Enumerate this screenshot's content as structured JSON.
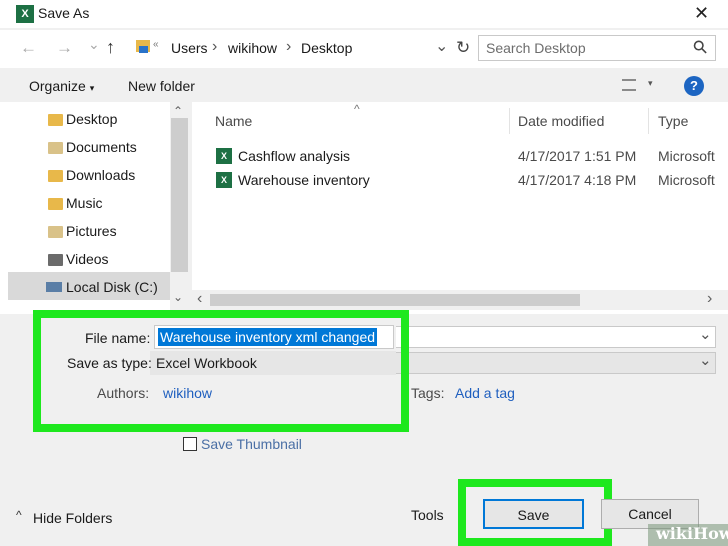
{
  "window": {
    "title": "Save As",
    "app_icon_text": "X",
    "close_glyph": "✕"
  },
  "nav": {
    "back_glyph": "←",
    "forward_glyph": "→",
    "recent_glyph": "⌄",
    "up_glyph": "↑",
    "breadcrumb": [
      "Users",
      "wikihow",
      "Desktop"
    ],
    "sep_glyph": "›",
    "leading_glyph": "«",
    "dropdown_glyph": "⌄",
    "refresh_glyph": "↻",
    "search_placeholder": "Search Desktop",
    "search_glyph": "⚲"
  },
  "toolbar": {
    "organize_label": "Organize",
    "organize_caret": "▾",
    "new_folder_label": "New folder",
    "view_caret": "▾",
    "help_glyph": "?"
  },
  "sidebar": {
    "items": [
      {
        "label": "Desktop",
        "icon": "desktop-folder-icon"
      },
      {
        "label": "Documents",
        "icon": "documents-folder-icon"
      },
      {
        "label": "Downloads",
        "icon": "downloads-folder-icon"
      },
      {
        "label": "Music",
        "icon": "music-folder-icon"
      },
      {
        "label": "Pictures",
        "icon": "pictures-folder-icon"
      },
      {
        "label": "Videos",
        "icon": "videos-folder-icon"
      },
      {
        "label": "Local Disk (C:)",
        "icon": "local-disk-icon"
      }
    ],
    "scroll_up_glyph": "⌃",
    "scroll_down_glyph": "⌄"
  },
  "files": {
    "sort_glyph": "^",
    "columns": [
      "Name",
      "Date modified",
      "Type"
    ],
    "rows": [
      {
        "name": "Cashflow analysis",
        "date": "4/17/2017 1:51 PM",
        "type": "Microsoft"
      },
      {
        "name": "Warehouse inventory",
        "date": "4/17/2017 4:18 PM",
        "type": "Microsoft"
      }
    ],
    "scroll_left_glyph": "‹",
    "scroll_right_glyph": "›"
  },
  "form": {
    "file_name_label": "File name:",
    "file_name_value": "Warehouse inventory xml changed",
    "save_type_label": "Save as type:",
    "save_type_value": "Excel Workbook",
    "authors_label": "Authors:",
    "authors_value": "wikihow",
    "tags_label": "Tags:",
    "tags_value": "Add a tag",
    "thumbnail_label": "Save Thumbnail",
    "dropdown_glyph": "⌄"
  },
  "footer": {
    "hide_folders_label": "Hide Folders",
    "hide_caret": "^",
    "tools_label": "Tools",
    "save_label": "Save",
    "cancel_label": "Cancel"
  },
  "watermark": {
    "text": "wikiHow"
  },
  "colors": {
    "highlight": "#1ee81e",
    "excel_green": "#1d7044",
    "link": "#1f5fbf",
    "select": "#0078d7"
  }
}
